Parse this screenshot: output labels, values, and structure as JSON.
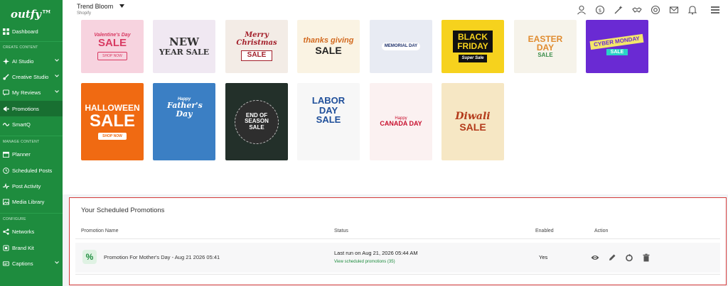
{
  "sidebar": {
    "logo": "outfy™",
    "sections": {
      "create": "CREATE CONTENT",
      "manage": "MANAGE CONTENT",
      "configure": "CONFIGURE"
    },
    "items": [
      {
        "label": "Dashboard",
        "icon": "dashboard-icon"
      },
      {
        "label": "AI Studio",
        "icon": "ai-icon"
      },
      {
        "label": "Creative Studio",
        "icon": "brush-icon"
      },
      {
        "label": "My Reviews",
        "icon": "reviews-icon"
      },
      {
        "label": "Promotions",
        "icon": "megaphone-icon"
      },
      {
        "label": "SmartQ",
        "icon": "smartq-icon"
      },
      {
        "label": "Planner",
        "icon": "calendar-icon"
      },
      {
        "label": "Scheduled Posts",
        "icon": "clock-icon"
      },
      {
        "label": "Post Activity",
        "icon": "activity-icon"
      },
      {
        "label": "Media Library",
        "icon": "image-icon"
      },
      {
        "label": "Networks",
        "icon": "network-icon"
      },
      {
        "label": "Brand Kit",
        "icon": "brand-icon"
      },
      {
        "label": "Captions",
        "icon": "caption-icon"
      }
    ]
  },
  "topbar": {
    "brand": "Trend Bloom",
    "platform": "Shopify",
    "icons": [
      "user-icon",
      "billing-icon",
      "magic-icon",
      "handshake-icon",
      "support-icon",
      "mail-icon",
      "bell-icon",
      "menu-icon"
    ]
  },
  "tiles": [
    {
      "t1": "Valentine's Day",
      "t2": "SALE",
      "btn": "SHOP NOW",
      "bg": "#f7d3df",
      "fg": "#d83a62"
    },
    {
      "t1": "NEW",
      "t2": "YEAR SALE",
      "bg": "#f0e8f2",
      "fg": "#333333"
    },
    {
      "t1": "Merry Christmas",
      "t2": "SALE",
      "bg": "#f3ece6",
      "fg": "#a3202b"
    },
    {
      "t1": "thanks giving",
      "t2": "SALE",
      "bg": "#faf3e3",
      "fg": "#d2691e"
    },
    {
      "t1": "MEMORIAL DAY",
      "t2": "",
      "bg": "#e8ebf3",
      "fg": "#1c2f6b"
    },
    {
      "t1": "BLACK FRIDAY",
      "t2": "Super Sale",
      "bg": "#f6d21d",
      "fg": "#111111"
    },
    {
      "t1": "EASTER DAY",
      "t2": "SALE",
      "bg": "#f6f3ea",
      "fg": "#e08b2f"
    },
    {
      "t1": "CYBER MONDAY",
      "t2": "SALE",
      "bg": "#6a2ad3",
      "fg": "#f3e66a"
    },
    {
      "t1": "HALLOWEEN",
      "t2": "SALE",
      "btn": "SHOP NOW",
      "bg": "#f06a12",
      "fg": "#ffffff"
    },
    {
      "t1": "Happy",
      "t2": "Father's Day",
      "bg": "#3b7fc4",
      "fg": "#ffffff"
    },
    {
      "t1": "END OF",
      "t2": "SEASON SALE",
      "bg": "#23302a",
      "fg": "#ffffff"
    },
    {
      "t1": "LABOR DAY",
      "t2": "SALE",
      "bg": "#f7f7f7",
      "fg": "#1f4f9a"
    },
    {
      "t1": "Happy",
      "t2": "CANADA DAY",
      "bg": "#fbf1f1",
      "fg": "#c8102e"
    },
    {
      "t1": "Diwali",
      "t2": "SALE",
      "bg": "#f6e7c4",
      "fg": "#b33a1a"
    }
  ],
  "scheduled": {
    "title": "Your Scheduled Promotions",
    "headers": {
      "name": "Promotion Name",
      "status": "Status",
      "enabled": "Enabled",
      "action": "Action"
    },
    "row": {
      "icon": "%",
      "name": "Promotion For Mother's Day - Aug 21 2026 05:41",
      "last_run": "Last run on Aug 21, 2026 05:44 AM",
      "link": "View scheduled promotions (35)",
      "enabled": "Yes"
    }
  },
  "colors": {
    "brand": "#1e8c3e",
    "highlight": "#d43a3a"
  }
}
